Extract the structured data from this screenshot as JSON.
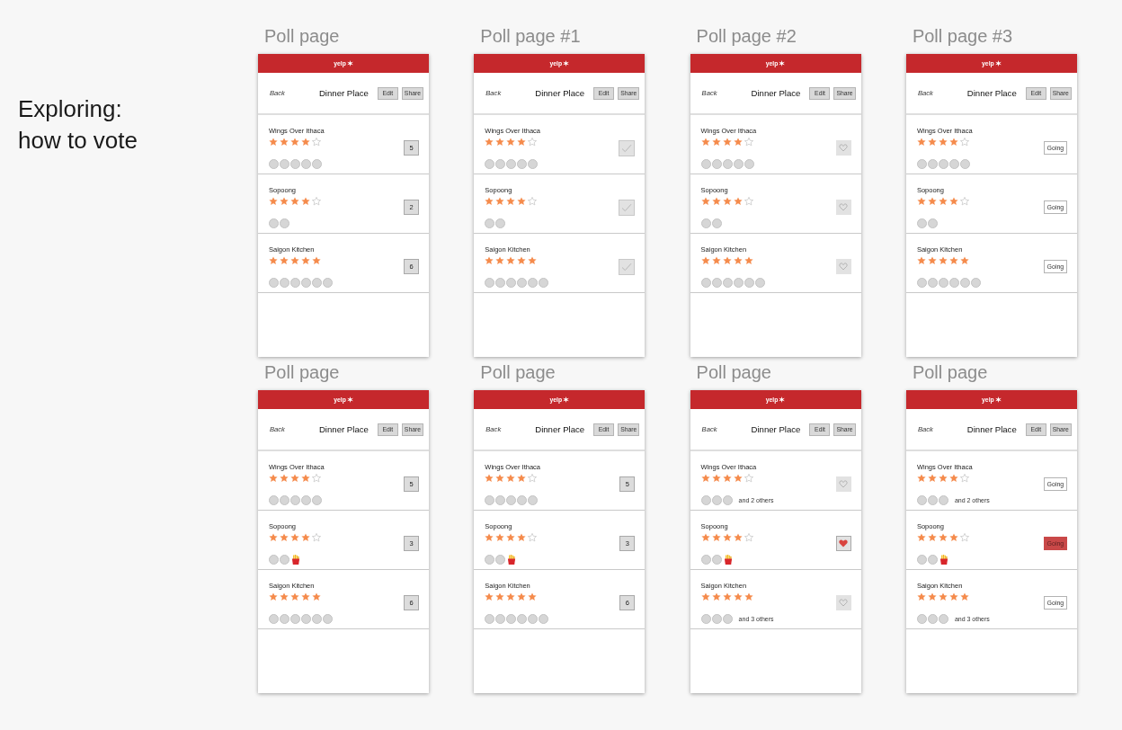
{
  "heading": "Exploring:\nhow to vote",
  "screens": [
    {
      "label": "Poll page",
      "logo": "yelp",
      "back": "Back",
      "title": "Dinner Place",
      "actions": [
        "Edit",
        "Share"
      ],
      "places": [
        {
          "name": "Wings Over Ithaca",
          "stars": 4,
          "voters": [
            {
              "kind": "avatar"
            },
            {
              "kind": "avatar"
            },
            {
              "kind": "avatar"
            },
            {
              "kind": "avatar"
            },
            {
              "kind": "avatar"
            }
          ],
          "vote": {
            "kind": "count",
            "label": "5"
          }
        },
        {
          "name": "Sopoong",
          "stars": 4,
          "voters": [
            {
              "kind": "avatar"
            },
            {
              "kind": "avatar"
            }
          ],
          "vote": {
            "kind": "count",
            "label": "2"
          }
        },
        {
          "name": "Saigon Kitchen",
          "stars": 5,
          "voters": [
            {
              "kind": "avatar"
            },
            {
              "kind": "avatar"
            },
            {
              "kind": "avatar"
            },
            {
              "kind": "avatar"
            },
            {
              "kind": "avatar"
            },
            {
              "kind": "avatar"
            }
          ],
          "vote": {
            "kind": "count",
            "label": "6"
          }
        }
      ]
    },
    {
      "label": "Poll page #1",
      "logo": "yelp",
      "back": "Back",
      "title": "Dinner Place",
      "actions": [
        "Edit",
        "Share"
      ],
      "places": [
        {
          "name": "Wings Over Ithaca",
          "stars": 4,
          "voters": [
            {
              "kind": "avatar"
            },
            {
              "kind": "avatar"
            },
            {
              "kind": "avatar"
            },
            {
              "kind": "avatar"
            },
            {
              "kind": "avatar"
            }
          ],
          "vote": {
            "kind": "check",
            "checked": false
          }
        },
        {
          "name": "Sopoong",
          "stars": 4,
          "voters": [
            {
              "kind": "avatar"
            },
            {
              "kind": "avatar"
            }
          ],
          "vote": {
            "kind": "check",
            "checked": false
          }
        },
        {
          "name": "Saigon Kitchen",
          "stars": 5,
          "voters": [
            {
              "kind": "avatar"
            },
            {
              "kind": "avatar"
            },
            {
              "kind": "avatar"
            },
            {
              "kind": "avatar"
            },
            {
              "kind": "avatar"
            },
            {
              "kind": "avatar"
            }
          ],
          "vote": {
            "kind": "check",
            "checked": false
          }
        }
      ]
    },
    {
      "label": "Poll page #2",
      "logo": "yelp",
      "back": "Back",
      "title": "Dinner Place",
      "actions": [
        "Edit",
        "Share"
      ],
      "places": [
        {
          "name": "Wings Over Ithaca",
          "stars": 4,
          "voters": [
            {
              "kind": "avatar"
            },
            {
              "kind": "avatar"
            },
            {
              "kind": "avatar"
            },
            {
              "kind": "avatar"
            },
            {
              "kind": "avatar"
            }
          ],
          "vote": {
            "kind": "heart",
            "selected": false
          }
        },
        {
          "name": "Sopoong",
          "stars": 4,
          "voters": [
            {
              "kind": "avatar"
            },
            {
              "kind": "avatar"
            }
          ],
          "vote": {
            "kind": "heart",
            "selected": false
          }
        },
        {
          "name": "Saigon Kitchen",
          "stars": 5,
          "voters": [
            {
              "kind": "avatar"
            },
            {
              "kind": "avatar"
            },
            {
              "kind": "avatar"
            },
            {
              "kind": "avatar"
            },
            {
              "kind": "avatar"
            },
            {
              "kind": "avatar"
            }
          ],
          "vote": {
            "kind": "heart",
            "selected": false
          }
        }
      ]
    },
    {
      "label": "Poll page #3",
      "logo": "yelp",
      "back": "Back",
      "title": "Dinner Place",
      "actions": [
        "Edit",
        "Share"
      ],
      "places": [
        {
          "name": "Wings Over Ithaca",
          "stars": 4,
          "voters": [
            {
              "kind": "avatar"
            },
            {
              "kind": "avatar"
            },
            {
              "kind": "avatar"
            },
            {
              "kind": "avatar"
            },
            {
              "kind": "avatar"
            }
          ],
          "vote": {
            "kind": "going",
            "label": "Going",
            "selected": false
          }
        },
        {
          "name": "Sopoong",
          "stars": 4,
          "voters": [
            {
              "kind": "avatar"
            },
            {
              "kind": "avatar"
            }
          ],
          "vote": {
            "kind": "going",
            "label": "Going",
            "selected": false
          }
        },
        {
          "name": "Saigon Kitchen",
          "stars": 5,
          "voters": [
            {
              "kind": "avatar"
            },
            {
              "kind": "avatar"
            },
            {
              "kind": "avatar"
            },
            {
              "kind": "avatar"
            },
            {
              "kind": "avatar"
            },
            {
              "kind": "avatar"
            }
          ],
          "vote": {
            "kind": "going",
            "label": "Going",
            "selected": false
          }
        }
      ]
    },
    {
      "label": "Poll page",
      "logo": "yelp",
      "back": "Back",
      "title": "Dinner Place",
      "actions": [
        "Edit",
        "Share"
      ],
      "places": [
        {
          "name": "Wings Over Ithaca",
          "stars": 4,
          "voters": [
            {
              "kind": "avatar"
            },
            {
              "kind": "avatar"
            },
            {
              "kind": "avatar"
            },
            {
              "kind": "avatar"
            },
            {
              "kind": "avatar"
            }
          ],
          "vote": {
            "kind": "count",
            "label": "5"
          }
        },
        {
          "name": "Sopoong",
          "stars": 4,
          "voters": [
            {
              "kind": "avatar"
            },
            {
              "kind": "avatar"
            },
            {
              "kind": "fries"
            }
          ],
          "vote": {
            "kind": "count",
            "label": "3"
          }
        },
        {
          "name": "Saigon Kitchen",
          "stars": 5,
          "voters": [
            {
              "kind": "avatar"
            },
            {
              "kind": "avatar"
            },
            {
              "kind": "avatar"
            },
            {
              "kind": "avatar"
            },
            {
              "kind": "avatar"
            },
            {
              "kind": "avatar"
            }
          ],
          "vote": {
            "kind": "count",
            "label": "6"
          }
        }
      ]
    },
    {
      "label": "Poll page",
      "logo": "yelp",
      "back": "Back",
      "title": "Dinner Place",
      "actions": [
        "Edit",
        "Share"
      ],
      "places": [
        {
          "name": "Wings Over Ithaca",
          "stars": 4,
          "voters": [
            {
              "kind": "avatar"
            },
            {
              "kind": "avatar"
            },
            {
              "kind": "avatar"
            },
            {
              "kind": "avatar"
            },
            {
              "kind": "avatar"
            }
          ],
          "vote": {
            "kind": "count",
            "label": "5"
          }
        },
        {
          "name": "Sopoong",
          "stars": 4,
          "voters": [
            {
              "kind": "avatar"
            },
            {
              "kind": "avatar"
            },
            {
              "kind": "fries"
            }
          ],
          "vote": {
            "kind": "count",
            "label": "3"
          }
        },
        {
          "name": "Saigon Kitchen",
          "stars": 5,
          "voters": [
            {
              "kind": "avatar"
            },
            {
              "kind": "avatar"
            },
            {
              "kind": "avatar"
            },
            {
              "kind": "avatar"
            },
            {
              "kind": "avatar"
            },
            {
              "kind": "avatar"
            }
          ],
          "vote": {
            "kind": "count",
            "label": "6"
          }
        }
      ]
    },
    {
      "label": "Poll page",
      "logo": "yelp",
      "back": "Back",
      "title": "Dinner Place",
      "actions": [
        "Edit",
        "Share"
      ],
      "places": [
        {
          "name": "Wings Over Ithaca",
          "stars": 4,
          "voters": [
            {
              "kind": "avatar"
            },
            {
              "kind": "avatar"
            },
            {
              "kind": "avatar"
            }
          ],
          "others": "and 2 others",
          "vote": {
            "kind": "heart",
            "selected": false
          }
        },
        {
          "name": "Sopoong",
          "stars": 4,
          "voters": [
            {
              "kind": "avatar"
            },
            {
              "kind": "avatar"
            },
            {
              "kind": "fries"
            }
          ],
          "vote": {
            "kind": "heart",
            "selected": true
          }
        },
        {
          "name": "Saigon Kitchen",
          "stars": 5,
          "voters": [
            {
              "kind": "avatar"
            },
            {
              "kind": "avatar"
            },
            {
              "kind": "avatar"
            }
          ],
          "others": "and 3 others",
          "vote": {
            "kind": "heart",
            "selected": false
          }
        }
      ]
    },
    {
      "label": "Poll page",
      "logo": "yelp",
      "back": "Back",
      "title": "Dinner Place",
      "actions": [
        "Edit",
        "Share"
      ],
      "places": [
        {
          "name": "Wings Over Ithaca",
          "stars": 4,
          "voters": [
            {
              "kind": "avatar"
            },
            {
              "kind": "avatar"
            },
            {
              "kind": "avatar"
            }
          ],
          "others": "and 2 others",
          "vote": {
            "kind": "going",
            "label": "Going",
            "selected": false
          }
        },
        {
          "name": "Sopoong",
          "stars": 4,
          "voters": [
            {
              "kind": "avatar"
            },
            {
              "kind": "avatar"
            },
            {
              "kind": "fries"
            }
          ],
          "vote": {
            "kind": "going",
            "label": "Going",
            "selected": true
          }
        },
        {
          "name": "Saigon Kitchen",
          "stars": 5,
          "voters": [
            {
              "kind": "avatar"
            },
            {
              "kind": "avatar"
            },
            {
              "kind": "avatar"
            }
          ],
          "others": "and 3 others",
          "vote": {
            "kind": "going",
            "label": "Going",
            "selected": false
          }
        }
      ]
    }
  ]
}
